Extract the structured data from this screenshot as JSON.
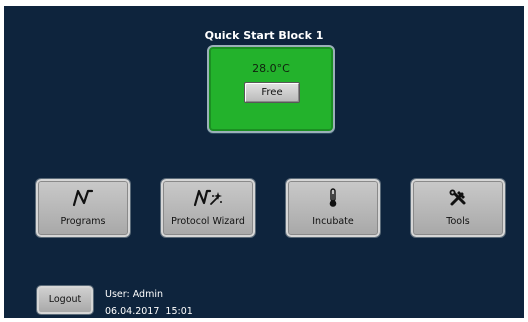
{
  "block": {
    "title": "Quick Start Block 1",
    "temperature": "28.0°C",
    "status_button": "Free",
    "tile_color": "#23b22c"
  },
  "menu": [
    {
      "label": "Programs",
      "icon": "programs-curve-icon"
    },
    {
      "label": "Protocol Wizard",
      "icon": "protocol-wizard-icon"
    },
    {
      "label": "Incubate",
      "icon": "thermometer-icon"
    },
    {
      "label": "Tools",
      "icon": "tools-icon"
    }
  ],
  "footer": {
    "logout_label": "Logout",
    "user": "User: Admin",
    "datetime": "06.04.2017  15:01"
  },
  "colors": {
    "background": "#0e243d",
    "button_face": "#bdbdbd"
  }
}
